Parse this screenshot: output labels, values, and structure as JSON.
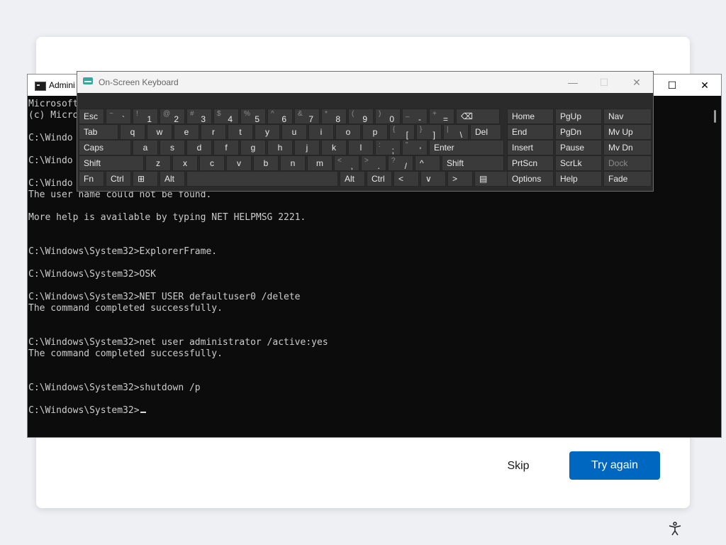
{
  "oobe": {
    "skip_label": "Skip",
    "try_again_label": "Try again",
    "accent_color": "#0067c0"
  },
  "cmd": {
    "title": "Admini",
    "controls": [
      "—",
      "☐",
      "✕"
    ],
    "lines": [
      "Microsoft",
      "(c) Micro",
      "",
      "C:\\Windo",
      "",
      "C:\\Windo",
      "",
      "C:\\Windo",
      "The user name could not be found.",
      "",
      "More help is available by typing NET HELPMSG 2221.",
      "",
      "",
      "C:\\Windows\\System32>ExplorerFrame.",
      "",
      "C:\\Windows\\System32>OSK",
      "",
      "C:\\Windows\\System32>NET USER defaultuser0 /delete",
      "The command completed successfully.",
      "",
      "",
      "C:\\Windows\\System32>net user administrator /active:yes",
      "The command completed successfully.",
      "",
      "",
      "C:\\Windows\\System32>shutdown /p",
      "",
      "C:\\Windows\\System32>"
    ]
  },
  "osk": {
    "title": "On-Screen Keyboard",
    "controls": [
      "—",
      "☐",
      "✕"
    ],
    "rows": [
      [
        {
          "main": "Esc",
          "w": 36
        },
        {
          "top": "~",
          "main": "`",
          "w": 36,
          "sym": true
        },
        {
          "top": "!",
          "main": "1",
          "w": 36,
          "sym": true
        },
        {
          "top": "@",
          "main": "2",
          "w": 36,
          "sym": true
        },
        {
          "top": "#",
          "main": "3",
          "w": 36,
          "sym": true
        },
        {
          "top": "$",
          "main": "4",
          "w": 36,
          "sym": true
        },
        {
          "top": "%",
          "main": "5",
          "w": 36,
          "sym": true
        },
        {
          "top": "^",
          "main": "6",
          "w": 36,
          "sym": true
        },
        {
          "top": "&",
          "main": "7",
          "w": 36,
          "sym": true
        },
        {
          "top": "*",
          "main": "8",
          "w": 36,
          "sym": true
        },
        {
          "top": "(",
          "main": "9",
          "w": 36,
          "sym": true
        },
        {
          "top": ")",
          "main": "0",
          "w": 36,
          "sym": true
        },
        {
          "top": "_",
          "main": "-",
          "w": 36,
          "sym": true
        },
        {
          "top": "+",
          "main": "=",
          "w": 36,
          "sym": true
        },
        {
          "main": "⌫",
          "w": 62
        }
      ],
      [
        {
          "main": "Tab",
          "w": 56
        },
        {
          "main": "q",
          "w": 36,
          "letter": true
        },
        {
          "main": "w",
          "w": 36,
          "letter": true
        },
        {
          "main": "e",
          "w": 36,
          "letter": true
        },
        {
          "main": "r",
          "w": 36,
          "letter": true
        },
        {
          "main": "t",
          "w": 36,
          "letter": true
        },
        {
          "main": "y",
          "w": 36,
          "letter": true
        },
        {
          "main": "u",
          "w": 36,
          "letter": true
        },
        {
          "main": "i",
          "w": 36,
          "letter": true
        },
        {
          "main": "o",
          "w": 36,
          "letter": true
        },
        {
          "main": "p",
          "w": 36,
          "letter": true
        },
        {
          "top": "{",
          "main": "[",
          "w": 36,
          "sym": true
        },
        {
          "top": "}",
          "main": "]",
          "w": 36,
          "sym": true
        },
        {
          "top": "|",
          "main": "\\",
          "w": 36,
          "sym": true
        },
        {
          "main": "Del",
          "w": 44
        }
      ],
      [
        {
          "main": "Caps",
          "w": 74
        },
        {
          "main": "a",
          "w": 36,
          "letter": true
        },
        {
          "main": "s",
          "w": 36,
          "letter": true
        },
        {
          "main": "d",
          "w": 36,
          "letter": true
        },
        {
          "main": "f",
          "w": 36,
          "letter": true
        },
        {
          "main": "g",
          "w": 36,
          "letter": true
        },
        {
          "main": "h",
          "w": 36,
          "letter": true
        },
        {
          "main": "j",
          "w": 36,
          "letter": true
        },
        {
          "main": "k",
          "w": 36,
          "letter": true
        },
        {
          "main": "l",
          "w": 36,
          "letter": true
        },
        {
          "top": ":",
          "main": ";",
          "w": 36,
          "sym": true
        },
        {
          "top": "\"",
          "main": "'",
          "w": 36,
          "sym": true
        },
        {
          "main": "Enter",
          "w": 106
        }
      ],
      [
        {
          "main": "Shift",
          "w": 92
        },
        {
          "main": "z",
          "w": 36,
          "letter": true
        },
        {
          "main": "x",
          "w": 36,
          "letter": true
        },
        {
          "main": "c",
          "w": 36,
          "letter": true
        },
        {
          "main": "v",
          "w": 36,
          "letter": true
        },
        {
          "main": "b",
          "w": 36,
          "letter": true
        },
        {
          "main": "n",
          "w": 36,
          "letter": true
        },
        {
          "main": "m",
          "w": 36,
          "letter": true
        },
        {
          "top": "<",
          "main": ",",
          "w": 36,
          "sym": true
        },
        {
          "top": ">",
          "main": ".",
          "w": 36,
          "sym": true
        },
        {
          "top": "?",
          "main": "/",
          "w": 36,
          "sym": true
        },
        {
          "main": "^",
          "w": 36
        },
        {
          "main": "Shift",
          "w": 88
        }
      ],
      [
        {
          "main": "Fn",
          "w": 36
        },
        {
          "main": "Ctrl",
          "w": 36
        },
        {
          "main": "⊞",
          "w": 36
        },
        {
          "main": "Alt",
          "w": 36
        },
        {
          "main": "",
          "w": 214
        },
        {
          "main": "Alt",
          "w": 36
        },
        {
          "main": "Ctrl",
          "w": 36
        },
        {
          "main": "<",
          "w": 36
        },
        {
          "main": "∨",
          "w": 36
        },
        {
          "main": ">",
          "w": 36
        },
        {
          "main": "▤",
          "w": 50
        }
      ]
    ],
    "nav": [
      [
        "Home",
        "PgUp",
        "Nav"
      ],
      [
        "End",
        "PgDn",
        "Mv Up"
      ],
      [
        "Insert",
        "Pause",
        "Mv Dn"
      ],
      [
        "PrtScn",
        "ScrLk",
        "Dock"
      ],
      [
        "Options",
        "Help",
        "Fade"
      ]
    ]
  }
}
